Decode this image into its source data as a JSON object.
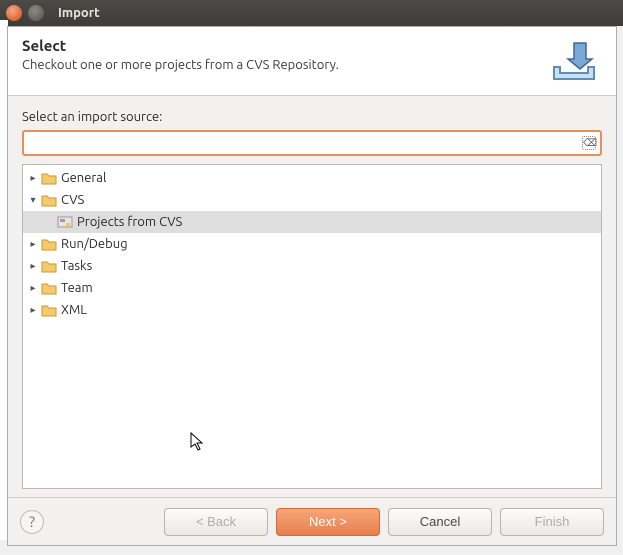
{
  "window": {
    "title": "Import"
  },
  "header": {
    "title": "Select",
    "subtitle": "Checkout one or more projects from a CVS Repository."
  },
  "body": {
    "filterLabel": "Select an import source:",
    "filterValue": ""
  },
  "tree": {
    "items": [
      {
        "label": "General",
        "expanded": false,
        "depth": 0,
        "type": "folder"
      },
      {
        "label": "CVS",
        "expanded": true,
        "depth": 0,
        "type": "folder"
      },
      {
        "label": "Projects from CVS",
        "expanded": false,
        "depth": 1,
        "type": "wizard",
        "selected": true
      },
      {
        "label": "Run/Debug",
        "expanded": false,
        "depth": 0,
        "type": "folder"
      },
      {
        "label": "Tasks",
        "expanded": false,
        "depth": 0,
        "type": "folder"
      },
      {
        "label": "Team",
        "expanded": false,
        "depth": 0,
        "type": "folder"
      },
      {
        "label": "XML",
        "expanded": false,
        "depth": 0,
        "type": "folder"
      }
    ]
  },
  "footer": {
    "back": "< Back",
    "next": "Next >",
    "cancel": "Cancel",
    "finish": "Finish"
  }
}
